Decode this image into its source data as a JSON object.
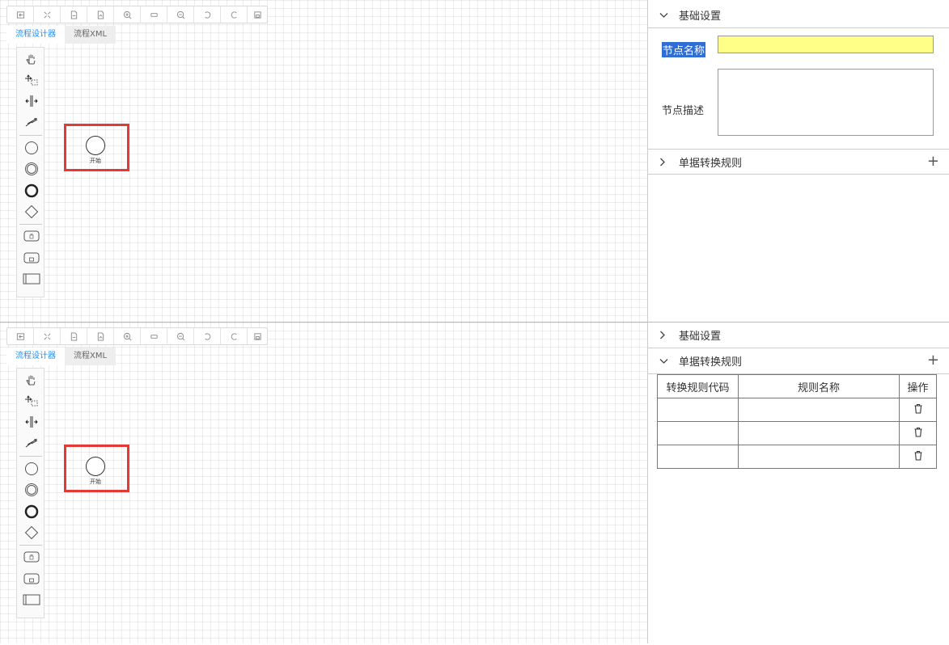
{
  "toolbar": {
    "buttons": [
      {
        "icon": "open-file-icon"
      },
      {
        "icon": "fit-icon"
      },
      {
        "icon": "download-xml-icon"
      },
      {
        "icon": "download-svg-icon"
      },
      {
        "icon": "zoom-in-icon"
      },
      {
        "icon": "reset-zoom-icon"
      },
      {
        "icon": "zoom-out-icon"
      },
      {
        "icon": "undo-icon"
      },
      {
        "icon": "redo-icon"
      },
      {
        "icon": "save-icon"
      }
    ]
  },
  "tabs": {
    "designer": "流程设计器",
    "xml": "流程XML"
  },
  "palette": {
    "items": [
      "hand-tool-icon",
      "lasso-tool-icon",
      "space-tool-icon",
      "connect-tool-icon",
      "start-event-icon",
      "intermediate-event-icon",
      "end-event-icon",
      "gateway-icon",
      "task-icon",
      "subprocess-icon",
      "pool-icon"
    ]
  },
  "canvas": {
    "start_label": "开始"
  },
  "props_top": {
    "basic_section": {
      "title": "基础设置",
      "expanded": true
    },
    "node_name_label": "节点名称",
    "node_name_value": "",
    "node_desc_label": "节点描述",
    "node_desc_value": "",
    "rules_section": {
      "title": "单据转换规则",
      "expanded": false,
      "add": "+"
    }
  },
  "props_bottom": {
    "basic_section": {
      "title": "基础设置",
      "expanded": false
    },
    "rules_section": {
      "title": "单据转换规则",
      "expanded": true,
      "add": "+"
    },
    "table": {
      "headers": [
        "转换规则代码",
        "规则名称",
        "操作"
      ],
      "rows": [
        {
          "code": "",
          "name": ""
        },
        {
          "code": "",
          "name": ""
        },
        {
          "code": "",
          "name": ""
        }
      ]
    }
  },
  "colors": {
    "accent": "#1890ff",
    "highlight": "#e53935",
    "selected_label": "#2f6fd5",
    "input_yellow": "#ffff88"
  }
}
